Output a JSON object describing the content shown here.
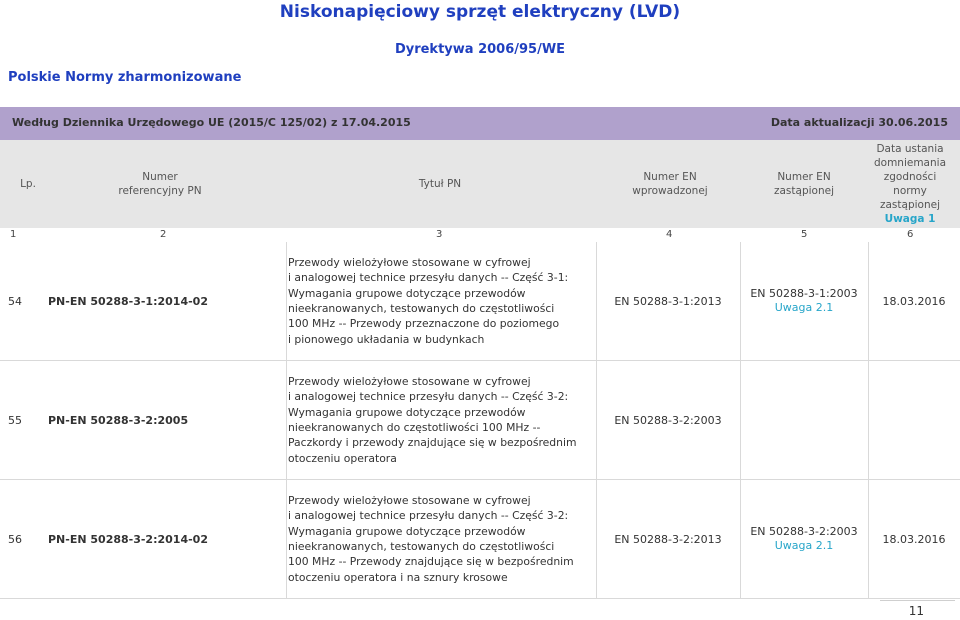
{
  "title": "Niskonapięciowy sprzęt elektryczny (LVD)",
  "directive": "Dyrektywa 2006/95/WE",
  "subtitle": "Polskie Normy zharmonizowane",
  "bar": {
    "left": "Według Dziennika Urzędowego UE (2015/C 125/02) z 17.04.2015",
    "right": "Data aktualizacji   30.06.2015"
  },
  "colors": {
    "bar": "#b0a1cc",
    "header": "#e6e6e6",
    "title": "#1f3fbf",
    "note": "#26a5c9"
  },
  "header": {
    "lp": "Lp.",
    "ref_line1": "Numer",
    "ref_line2": "referencyjny PN",
    "title": "Tytuł PN",
    "ennew_line1": "Numer EN",
    "ennew_line2": "wprowadzonej",
    "enold_line1": "Numer EN",
    "enold_line2": "zastąpionej",
    "date_line1": "Data ustania",
    "date_line2": "domniemania",
    "date_line3": "zgodności",
    "date_line4": "normy",
    "date_line5": "zastąpionej",
    "date_note": "Uwaga 1"
  },
  "colnums": [
    "1",
    "2",
    "3",
    "4",
    "5",
    "6"
  ],
  "rows": [
    {
      "lp": "54",
      "ref": "PN-EN 50288-3-1:2014-02",
      "title": "Przewody wielożyłowe stosowane w cyfrowej\ni analogowej technice przesyłu danych -- Część 3-1:\nWymagania grupowe dotyczące przewodów\nnieekranowanych, testowanych do częstotliwości\n100 MHz -- Przewody przeznaczone do poziomego\ni pionowego układania w budynkach",
      "en_new": "EN 50288-3-1:2013",
      "en_old": "EN 50288-3-1:2003",
      "en_old_note": "Uwaga 2.1",
      "date": "18.03.2016"
    },
    {
      "lp": "55",
      "ref": "PN-EN 50288-3-2:2005",
      "title": "Przewody wielożyłowe stosowane w cyfrowej\ni analogowej technice przesyłu danych -- Część 3-2:\nWymagania grupowe dotyczące przewodów\nnieekranowanych do częstotliwości 100 MHz --\nPaczkordy i przewody znajdujące się w bezpośrednim\notoczeniu operatora",
      "en_new": "EN 50288-3-2:2003",
      "en_old": "",
      "en_old_note": "",
      "date": ""
    },
    {
      "lp": "56",
      "ref": "PN-EN 50288-3-2:2014-02",
      "title": "Przewody wielożyłowe stosowane w cyfrowej\ni analogowej technice przesyłu danych -- Część 3-2:\nWymagania grupowe dotyczące przewodów\nnieekranowanych, testowanych do częstotliwości\n100 MHz -- Przewody znajdujące się w bezpośrednim\notoczeniu operatora i na sznury krosowe",
      "en_new": "EN 50288-3-2:2013",
      "en_old": "EN 50288-3-2:2003",
      "en_old_note": "Uwaga 2.1",
      "date": "18.03.2016"
    }
  ],
  "page_number": "11"
}
